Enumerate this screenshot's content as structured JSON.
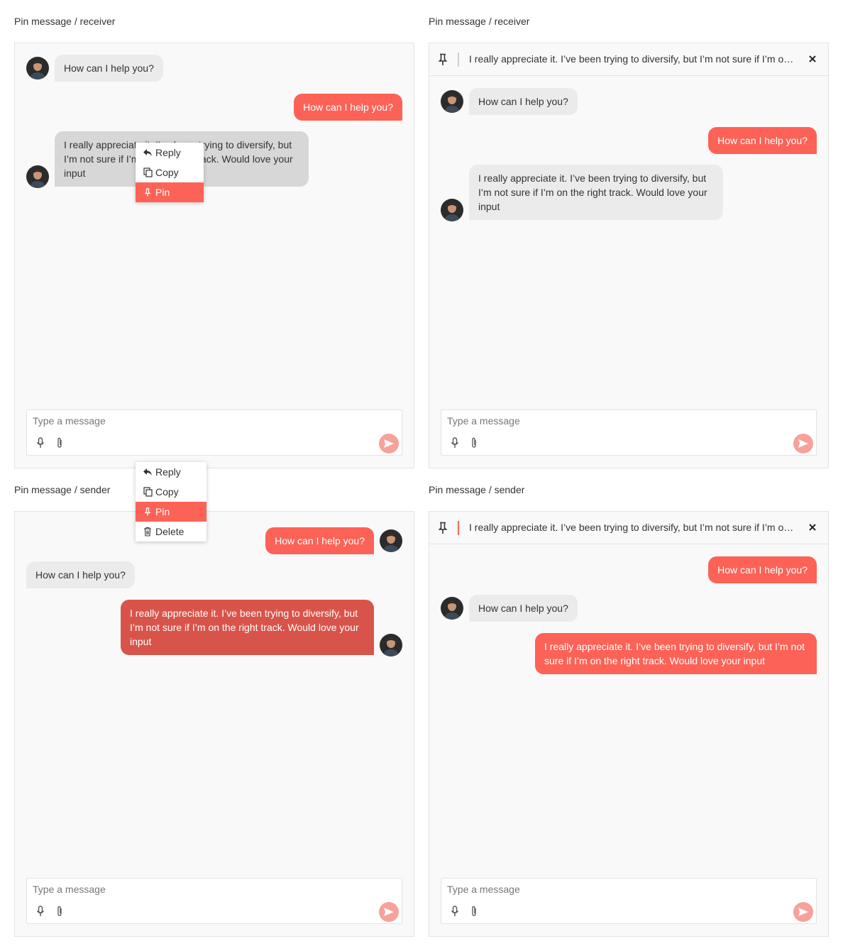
{
  "panels": [
    {
      "label": "Pin message / receiver",
      "messages": [
        {
          "text": "How can I help you?"
        },
        {
          "text": "How can I help you?"
        },
        {
          "text": "I really appreciate it. I’ve been trying to diversify, but I’m not sure if I’m on the right track. Would love your input"
        }
      ],
      "composer": {
        "placeholder": "Type a message"
      }
    },
    {
      "label": "Pin message / receiver",
      "pinned_text": "I really appreciate it. I’ve been trying to diversify, but I’m not sure if I’m on the right track. Would love your input",
      "messages": [
        {
          "text": "How can I help you?"
        },
        {
          "text": "How can I help you?"
        },
        {
          "text": "I really appreciate it. I’ve been trying to diversify, but I’m not sure if I’m on the right track. Would love your input"
        }
      ],
      "composer": {
        "placeholder": "Type a message"
      }
    },
    {
      "label": "Pin message / sender",
      "messages": [
        {
          "text": "How can I help you?"
        },
        {
          "text": "How can I help you?"
        },
        {
          "text": "I really appreciate it. I’ve been trying to diversify, but I’m not sure if I’m on the right track. Would love your input"
        }
      ],
      "composer": {
        "placeholder": "Type a message"
      }
    },
    {
      "label": "Pin message / sender",
      "pinned_text": "I really appreciate it. I’ve been trying to diversify, but I’m not sure if I’m on the right track. Would love your input",
      "messages": [
        {
          "text": "How can I help you?"
        },
        {
          "text": "How can I help you?"
        },
        {
          "text": "I really appreciate it. I’ve been trying to diversify, but I’m not sure if I’m on the right track. Would love your input"
        }
      ],
      "composer": {
        "placeholder": "Type a message"
      }
    }
  ],
  "context_menus": {
    "receiver": {
      "items": [
        {
          "label": "Reply",
          "icon": "reply-icon"
        },
        {
          "label": "Copy",
          "icon": "copy-icon"
        },
        {
          "label": "Pin",
          "icon": "pin-icon",
          "active": true
        }
      ]
    },
    "sender": {
      "items": [
        {
          "label": "Reply",
          "icon": "reply-icon"
        },
        {
          "label": "Copy",
          "icon": "copy-icon"
        },
        {
          "label": "Pin",
          "icon": "pin-icon",
          "active": true
        },
        {
          "label": "Delete",
          "icon": "trash-icon"
        }
      ]
    }
  },
  "colors": {
    "accent": "#fd6257",
    "accent_dark": "#d8544a",
    "incoming_bubble": "#ebebeb",
    "incoming_bubble_selected": "#d7d7d7",
    "send_button": "#f7a19a",
    "panel_background": "#f9f9f9"
  }
}
